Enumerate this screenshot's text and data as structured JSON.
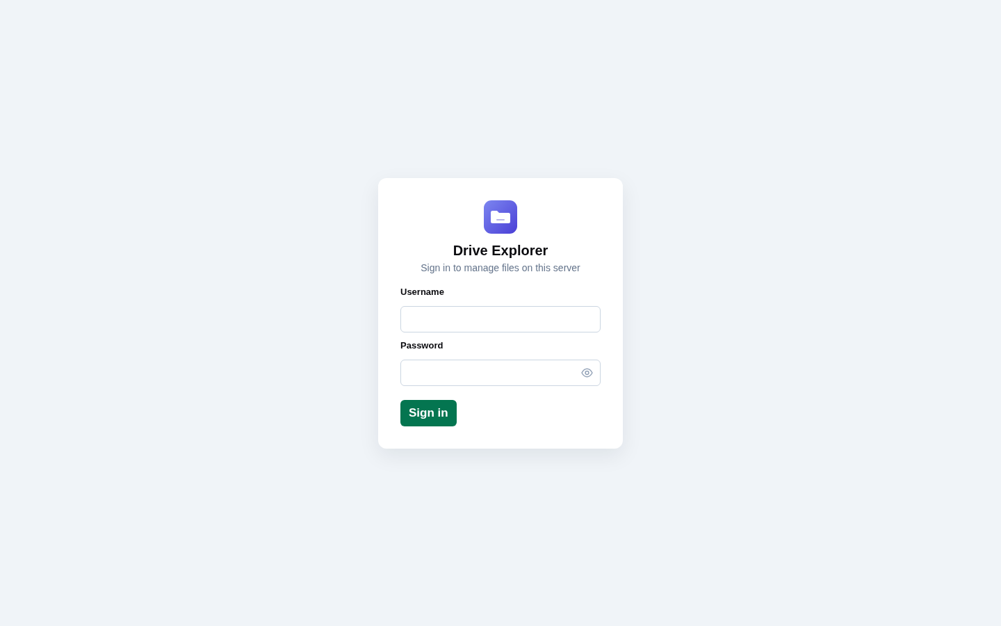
{
  "app": {
    "title": "Drive Explorer",
    "subtitle": "Sign in to manage files on this server"
  },
  "fields": [
    {
      "label": "Username",
      "kind": "text"
    },
    {
      "label": "Password",
      "kind": "password"
    }
  ],
  "submit": {
    "label": "Sign in"
  }
}
